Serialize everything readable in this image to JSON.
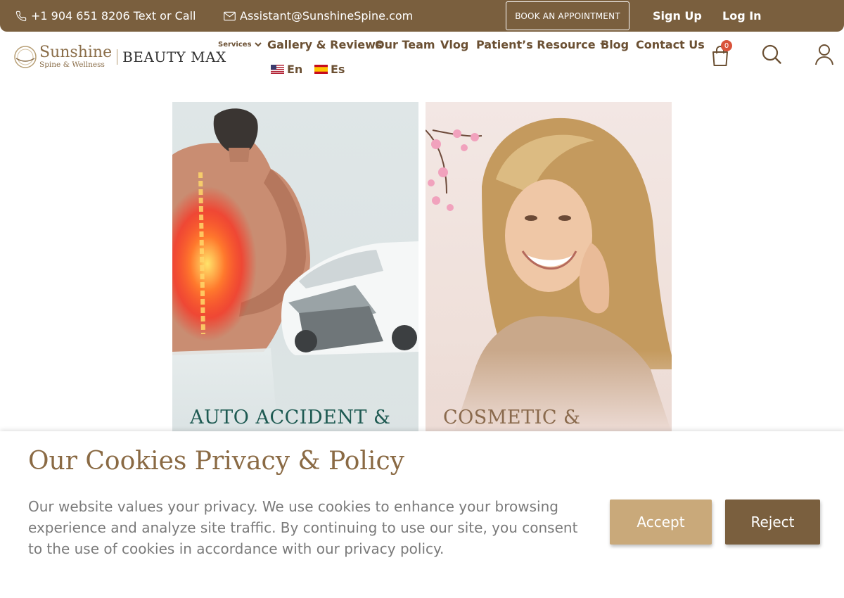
{
  "topbar": {
    "phone": "+1 904 651 8206 Text or Call",
    "email": "Assistant@SunshineSpine.com",
    "book_label": "BOOK AN APPOINTMENT",
    "signup_label": "Sign Up",
    "login_label": "Log In"
  },
  "logo": {
    "brand": "Sunshine",
    "tagline": "Spine & Wellness",
    "partner": "BEAUTY MAX"
  },
  "nav": {
    "services": "Services",
    "gallery": "Gallery & Reviews",
    "team": "Our Team",
    "vlog": "Vlog",
    "resource": "Patient’s Resource",
    "blog": "Blog",
    "contact": "Contact Us"
  },
  "lang": {
    "en": "En",
    "es": "Es"
  },
  "cart": {
    "count": "0"
  },
  "cards": {
    "left_title": "AUTO ACCIDENT &",
    "right_title": "COSMETIC &"
  },
  "cookie": {
    "title": "Our Cookies Privacy & Policy",
    "text": "Our website values your privacy. We use cookies to enhance your browsing experience and analyze site traffic. By continuing to use our site, you consent to the use of cookies in accordance with our privacy policy.",
    "accept_label": "Accept",
    "reject_label": "Reject"
  },
  "colors": {
    "brand_brown": "#7a5f3e",
    "accent_tan": "#c9a97a",
    "badge_red": "#d9533b"
  },
  "icons": [
    "phone-icon",
    "mail-icon",
    "chevron-down-icon",
    "cart-icon",
    "search-icon",
    "user-icon"
  ]
}
